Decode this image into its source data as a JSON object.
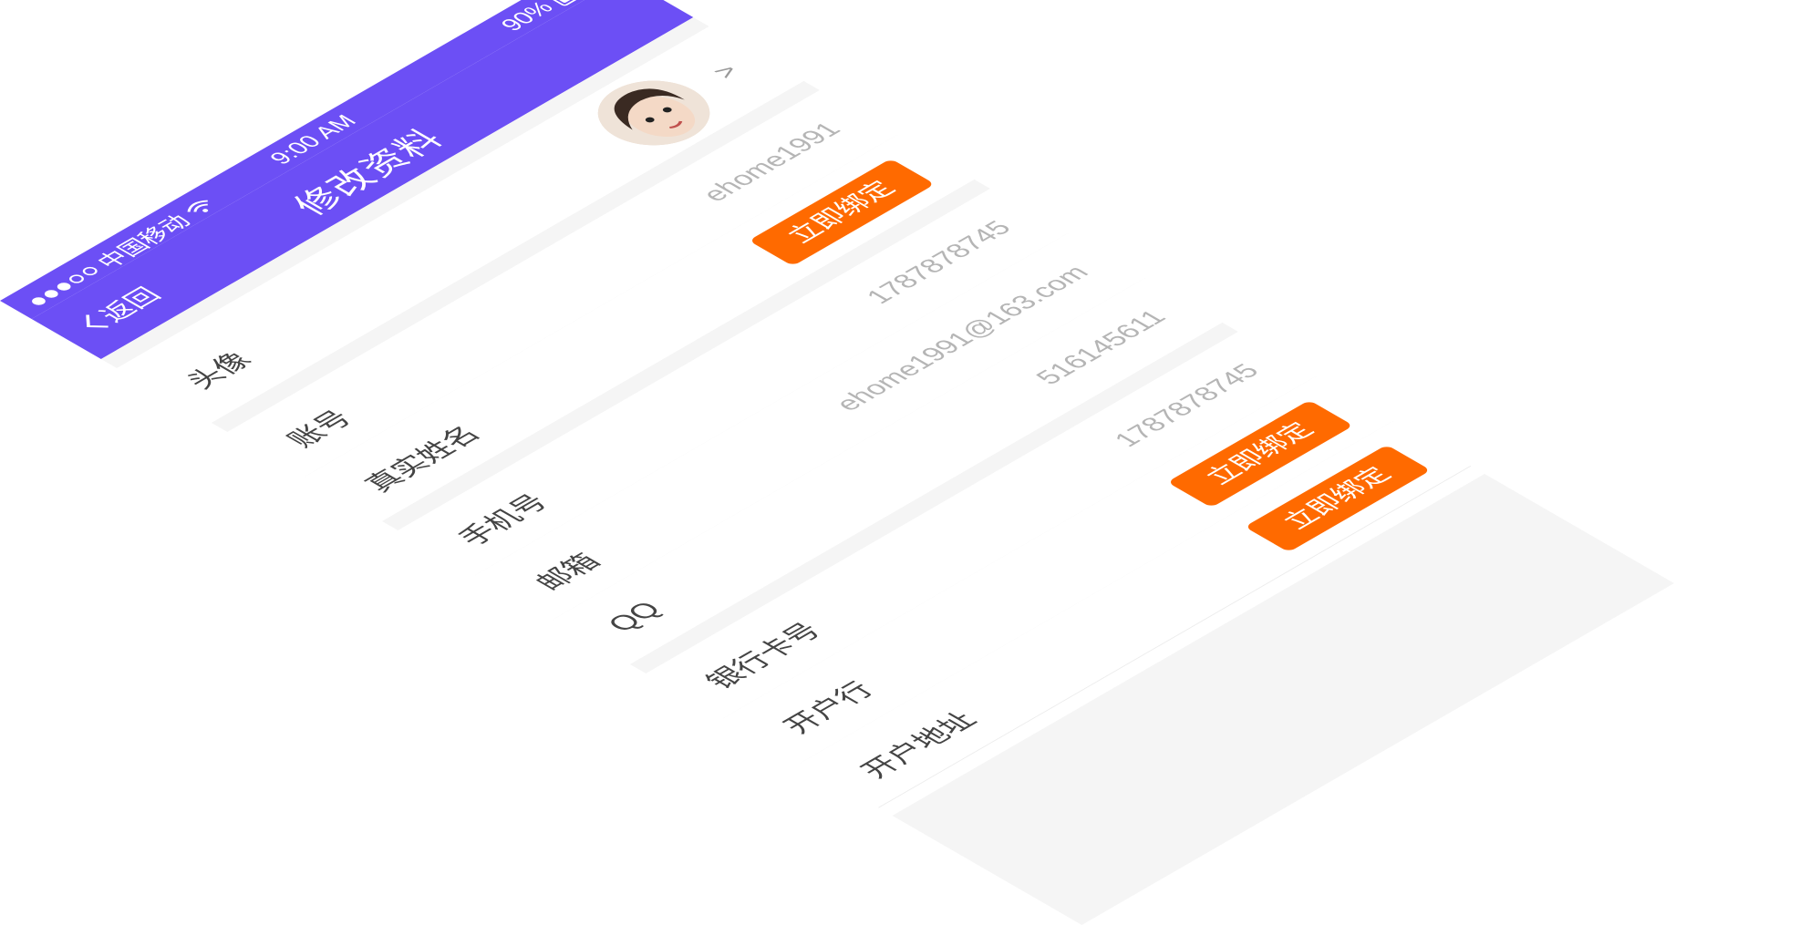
{
  "status_bar": {
    "carrier": "中国移动",
    "time": "9:00 AM",
    "battery": "90%",
    "battery_level": 0.9,
    "signal_icon": "signal-dots-icon",
    "wifi_icon": "wifi-icon"
  },
  "nav": {
    "back_label": "返回",
    "title": "修改资料",
    "back_icon": "chevron-left-icon",
    "color": "#6c4ff5"
  },
  "rows": {
    "avatar": {
      "label": "头像"
    },
    "account": {
      "label": "账号",
      "value": "ehome1991"
    },
    "real_name": {
      "label": "真实姓名",
      "button": "立即绑定"
    },
    "phone": {
      "label": "手机号",
      "value": "1787878745"
    },
    "email": {
      "label": "邮箱",
      "value": "ehome1991@163.com"
    },
    "qq": {
      "label": "QQ",
      "value": "516145611"
    },
    "bank_card": {
      "label": "银行卡号",
      "value": "1787878745"
    },
    "bank": {
      "label": "开户行",
      "button": "立即绑定"
    },
    "bank_address": {
      "label": "开户地址",
      "button": "立即绑定"
    }
  },
  "colors": {
    "accent": "#6c4ff5",
    "bind_button": "#ff6a00"
  }
}
